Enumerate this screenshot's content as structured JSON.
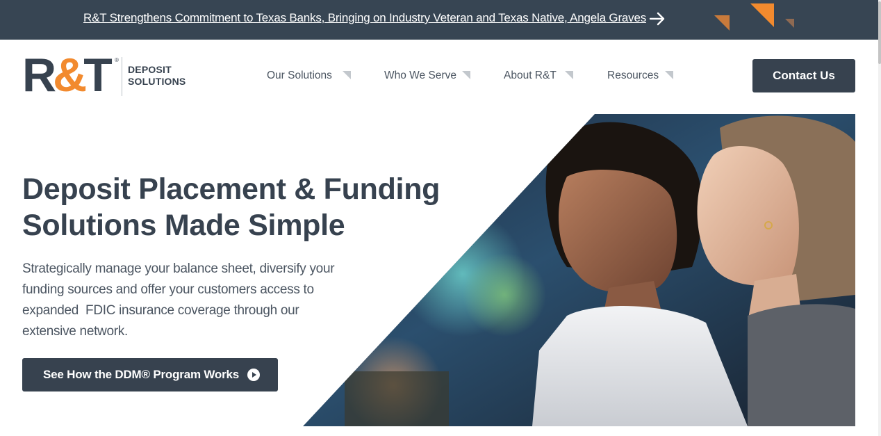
{
  "announcement": {
    "text": "R&T Strengthens Commitment to Texas Banks, Bringing on Industry Veteran and Texas Native, Angela Graves",
    "arrow_icon": "arrow-right-icon"
  },
  "brand": {
    "logo_r": "R",
    "logo_amp": "&",
    "logo_t": "T",
    "logo_reg": "®",
    "logo_line1": "DEPOSIT",
    "logo_line2": "SOLUTIONS",
    "colors": {
      "navy": "#37424f",
      "orange": "#f28a2e"
    }
  },
  "nav": {
    "items": [
      {
        "label": "Our Solutions"
      },
      {
        "label": "Who We Serve"
      },
      {
        "label": "About R&T"
      },
      {
        "label": "Resources"
      }
    ],
    "contact_label": "Contact Us"
  },
  "hero": {
    "title_line1": "Deposit Placement & Funding",
    "title_line2": "Solutions Made Simple",
    "subtitle_line1": "Strategically manage your balance sheet, diversify your",
    "subtitle_line2": "funding sources and offer your customers access to",
    "subtitle_line3": "expanded  FDIC insurance coverage through our",
    "subtitle_line4": "extensive network.",
    "cta_label": "See How the DDM® Program Works",
    "cta_icon": "play-circle-icon"
  }
}
